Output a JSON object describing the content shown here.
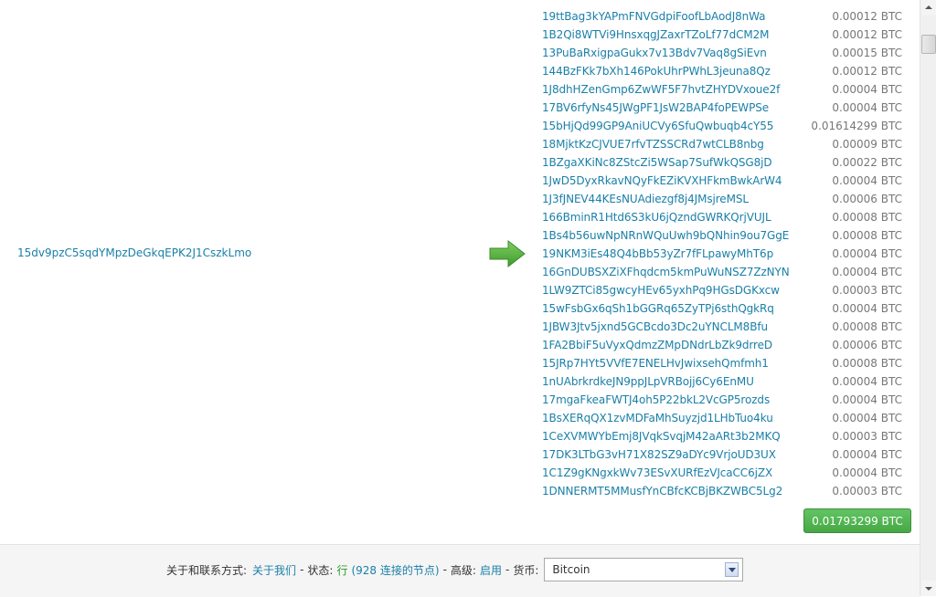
{
  "transaction": {
    "input_address": "15dv9pzC5sqdYMpzDeGkqEPK2J1CszkLmo",
    "outputs": [
      {
        "address": "19ttBag3kYAPmFNVGdpiFoofLbAodJ8nWa",
        "amount": "0.00012 BTC"
      },
      {
        "address": "1B2Qi8WTVi9HnsxqgJZaxrTZoLf77dCM2M",
        "amount": "0.00012 BTC"
      },
      {
        "address": "13PuBaRxigpaGukx7v13Bdv7Vaq8gSiEvn",
        "amount": "0.00015 BTC"
      },
      {
        "address": "144BzFKk7bXh146PokUhrPWhL3jeuna8Qz",
        "amount": "0.00012 BTC"
      },
      {
        "address": "1J8dhHZenGmp6ZwWF5F7hvtZHYDVxoue2f",
        "amount": "0.00004 BTC"
      },
      {
        "address": "17BV6rfyNs45JWgPF1JsW2BAP4foPEWPSe",
        "amount": "0.00004 BTC"
      },
      {
        "address": "15bHjQd99GP9AniUCVy6SfuQwbuqb4cY55",
        "amount": "0.01614299 BTC"
      },
      {
        "address": "18MjktKzCJVUE7rfvTZSSCRd7wtCLB8nbg",
        "amount": "0.00009 BTC"
      },
      {
        "address": "1BZgaXKiNc8ZStcZi5WSap7SufWkQSG8jD",
        "amount": "0.00022 BTC"
      },
      {
        "address": "1JwD5DyxRkavNQyFkEZiKVXHFkmBwkArW4",
        "amount": "0.00004 BTC"
      },
      {
        "address": "1J3fJNEV44KEsNUAdiezgf8j4JMsjreMSL",
        "amount": "0.00006 BTC"
      },
      {
        "address": "166BminR1Htd6S3kU6jQzndGWRKQrjVUJL",
        "amount": "0.00008 BTC"
      },
      {
        "address": "1Bs4b56uwNpNRnWQuUwh9bQNhin9ou7GgE",
        "amount": "0.00008 BTC"
      },
      {
        "address": "19NKM3iEs48Q4bBb53yZr7fFLpawyMhT6p",
        "amount": "0.00004 BTC"
      },
      {
        "address": "16GnDUBSXZiXFhqdcm5kmPuWuNSZ7ZzNYN",
        "amount": "0.00004 BTC"
      },
      {
        "address": "1LW9ZTCi85gwcyHEv65yxhPq9HGsDGKxcw",
        "amount": "0.00003 BTC"
      },
      {
        "address": "15wFsbGx6qSh1bGGRq65ZyTPj6sthQgkRq",
        "amount": "0.00004 BTC"
      },
      {
        "address": "1JBW3Jtv5jxnd5GCBcdo3Dc2uYNCLM8Bfu",
        "amount": "0.00008 BTC"
      },
      {
        "address": "1FA2BbiF5uVyxQdmzZMpDNdrLbZk9drreD",
        "amount": "0.00006 BTC"
      },
      {
        "address": "15JRp7HYt5VVfE7ENELHvJwixsehQmfmh1",
        "amount": "0.00008 BTC"
      },
      {
        "address": "1nUAbrkrdkeJN9ppJLpVRBojj6Cy6EnMU",
        "amount": "0.00004 BTC"
      },
      {
        "address": "17mgaFkeaFWTJ4oh5P22bkL2VcGP5rozds",
        "amount": "0.00004 BTC"
      },
      {
        "address": "1BsXERqQX1zvMDFaMhSuyzjd1LHbTuo4ku",
        "amount": "0.00004 BTC"
      },
      {
        "address": "1CeXVMWYbEmj8JVqkSvqjM42aARt3b2MKQ",
        "amount": "0.00003 BTC"
      },
      {
        "address": "17DK3LTbG3vH71X82SZ9aDYc9VrjoUD3UX",
        "amount": "0.00004 BTC"
      },
      {
        "address": "1C1Z9gKNgxkWv73ESvXURfEzVJcaCC6jZX",
        "amount": "0.00004 BTC"
      },
      {
        "address": "1DNNERMT5MMusfYnCBfcKCBjBKZWBC5Lg2",
        "amount": "0.00003 BTC"
      }
    ],
    "total": "0.01793299 BTC"
  },
  "footer": {
    "about_label": "关于和联系方式:",
    "about_link": "关于我们",
    "sep1": "-",
    "status_label": "状态:",
    "status_value": "行",
    "status_nodes": "(928 连接的节点)",
    "sep2": "-",
    "advanced_label": "高级:",
    "advanced_value": "启用",
    "sep3": "-",
    "currency_label": "货币:",
    "currency_value": "Bitcoin"
  },
  "colors": {
    "link": "#1a7fa8",
    "amount": "#777777",
    "total_button": "#51b551",
    "arrow": "#4caa3c",
    "status_ok": "#2a9a2a"
  },
  "icons": {
    "arrow": "arrow-right-icon",
    "dropdown": "chevron-down-icon"
  }
}
